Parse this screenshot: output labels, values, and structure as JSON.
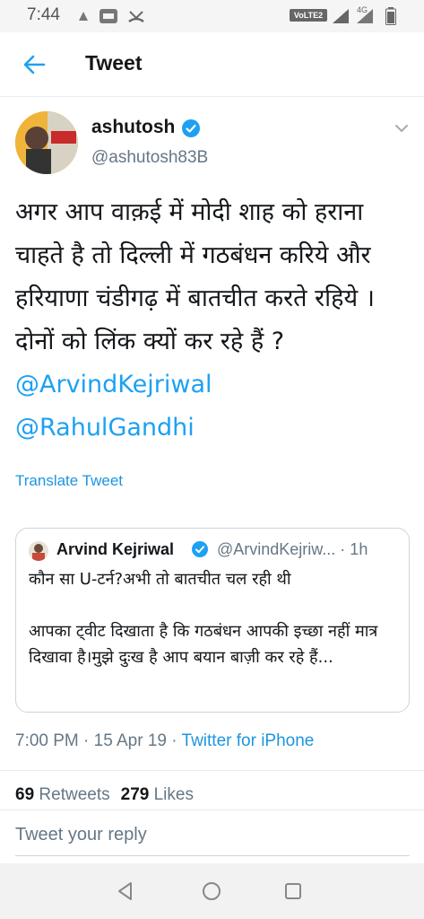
{
  "status_bar": {
    "time": "7:44",
    "network_badge": "VoLTE2",
    "signal_label": "4G"
  },
  "header": {
    "title": "Tweet"
  },
  "tweet": {
    "author_name": "ashutosh",
    "author_handle": "@ashutosh83B",
    "text": "अगर आप वाक़ई में मोदी शाह को हराना चाहते है तो दिल्ली में गठबंधन करिये और हरियाणा चंडीगढ़ में बातचीत करते रहिये । दोनों को लिंक क्यों कर रहे हैं ? ",
    "mention_1": "@ArvindKejriwal",
    "mention_2": "@RahulGandhi",
    "translate_label": "Translate Tweet",
    "timestamp": "7:00 PM · 15 Apr 19 · ",
    "source": "Twitter for iPhone",
    "retweets_count": "69",
    "retweets_label": "Retweets",
    "likes_count": "279",
    "likes_label": "Likes"
  },
  "quoted_tweet": {
    "author_name": "Arvind Kejriwal",
    "meta": "@ArvindKejriw... · 1h",
    "text": "कौन सा U-टर्न?अभी तो बातचीत चल रही थी\n\nआपका ट्वीट दिखाता है कि गठबंधन आपकी इच्छा नहीं मात्र दिखावा है।मुझे दुःख है आप बयान बाज़ी कर रहे हैं..."
  },
  "reply": {
    "placeholder": "Tweet your reply"
  },
  "colors": {
    "accent": "#1da1f2",
    "verified": "#1da1f2",
    "muted": "#657786"
  },
  "icons": {
    "back": "arrow-left-icon",
    "verified": "verified-badge-icon",
    "caret": "chevron-down-icon",
    "nav_back": "triangle-back-icon",
    "nav_home": "circle-home-icon",
    "nav_recents": "square-recents-icon"
  }
}
